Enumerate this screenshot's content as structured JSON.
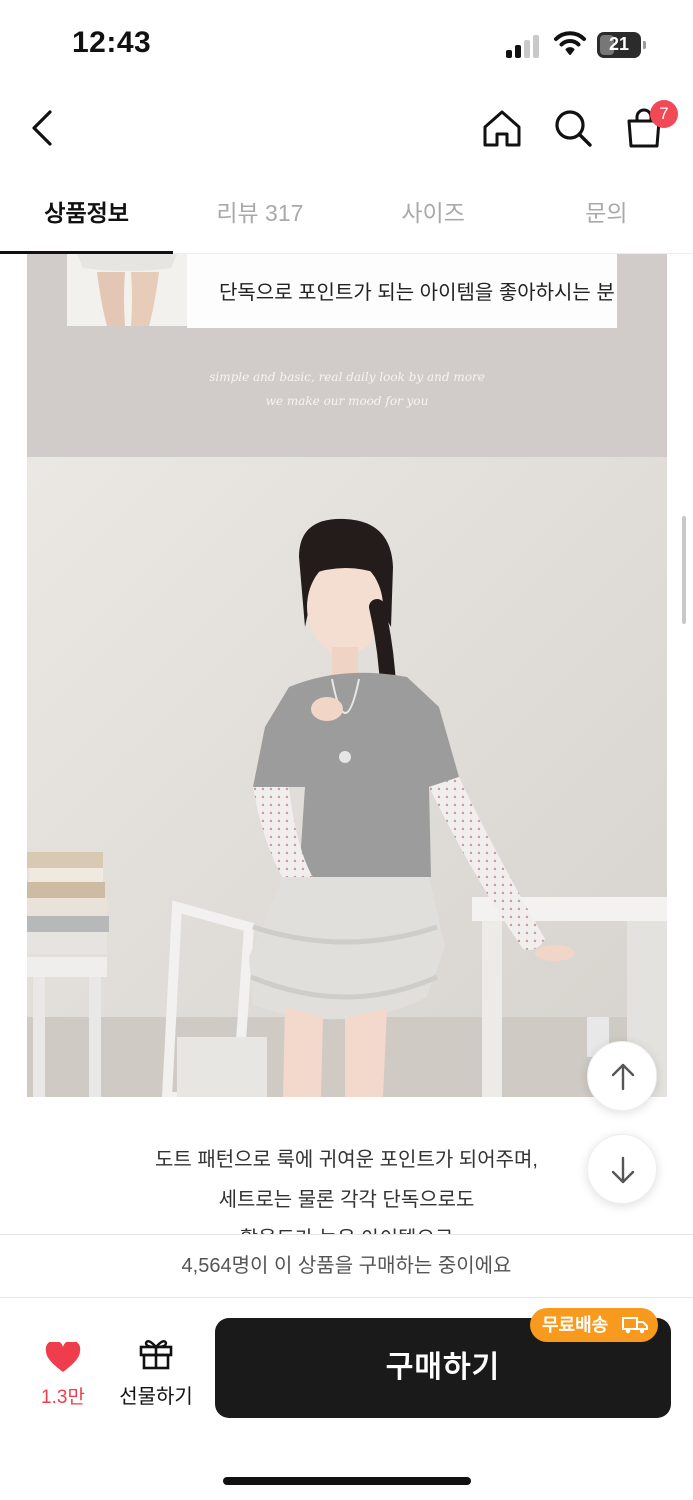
{
  "status_bar": {
    "time": "12:43",
    "battery": "21"
  },
  "header": {
    "cart_count": "7"
  },
  "tabs": [
    {
      "label": "상품정보",
      "active": true
    },
    {
      "label": "리뷰 317",
      "active": false
    },
    {
      "label": "사이즈",
      "active": false
    },
    {
      "label": "문의",
      "active": false
    }
  ],
  "content": {
    "caption": "단독으로 포인트가 되는 아이템을 좋아하시는 분",
    "script_line1": "simple and basic, real daily look by and more",
    "script_line2": "we make our mood for you",
    "desc_line1": "도트 패턴으로 룩에 귀여운 포인트가 되어주며,",
    "desc_line2": "세트로는 물론 각각 단독으로도",
    "desc_line3": "활용도가 높은 아이템으로"
  },
  "buyers_text": "4,564명이 이 상품을 구매하는 중이에요",
  "bottom_bar": {
    "like_count": "1.3만",
    "gift_label": "선물하기",
    "buy_label": "구매하기",
    "free_shipping_label": "무료배송"
  },
  "colors": {
    "accent_red": "#ef3d4d",
    "badge": "#f24957",
    "buy_button": "#1a1a1a",
    "free_shipping": "#f79a1e"
  }
}
